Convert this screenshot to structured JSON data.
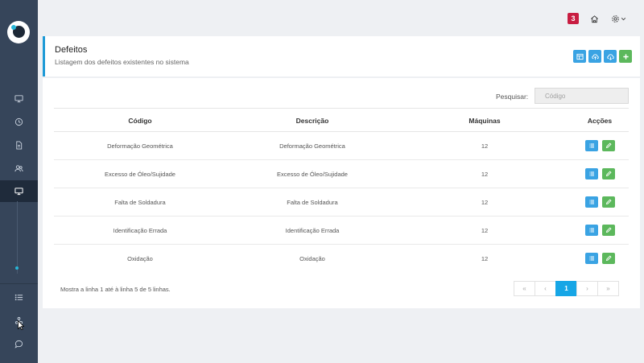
{
  "topbar": {
    "notification_count": "3",
    "home_icon": "home-icon",
    "settings_icon": "gear-icon"
  },
  "sidebar": {
    "icons": [
      "monitor-icon",
      "clock-icon",
      "document-icon",
      "users-icon",
      "monitor-active-icon",
      "list-icon",
      "settings-sliders-icon",
      "chat-icon"
    ]
  },
  "header": {
    "title": "Defeitos",
    "subtitle": "Listagem dos defeitos existentes no sistema",
    "toolbar": [
      "table-icon",
      "cloud-upload-icon",
      "cloud-download-icon",
      "plus-icon"
    ]
  },
  "search": {
    "label": "Pesquisar:",
    "placeholder": "Código",
    "value": ""
  },
  "table": {
    "columns": [
      "Código",
      "Descrição",
      "Máquinas",
      "Acções"
    ],
    "rows": [
      {
        "codigo": "Deformação Geométrica",
        "descricao": "Deformação Geométrica",
        "maquinas": "12"
      },
      {
        "codigo": "Excesso de Óleo/Sujidade",
        "descricao": "Excesso de Óleo/Sujidade",
        "maquinas": "12"
      },
      {
        "codigo": "Falta de Soldadura",
        "descricao": "Falta de Soldadura",
        "maquinas": "12"
      },
      {
        "codigo": "Identificação Errada",
        "descricao": "Identificação Errada",
        "maquinas": "12"
      },
      {
        "codigo": "Oxidação",
        "descricao": "Oxidação",
        "maquinas": "12"
      }
    ]
  },
  "footer": {
    "summary": "Mostra a linha 1 até à linha 5 de 5 linhas."
  },
  "pagination": {
    "first": "«",
    "prev": "‹",
    "current": "1",
    "next": "›",
    "last": "»"
  },
  "colors": {
    "sidebar": "#36455a",
    "accent_blue": "#3aa3e3",
    "accent_green": "#5cb85c",
    "badge_red": "#c81d41",
    "page_active": "#16a6e6"
  }
}
